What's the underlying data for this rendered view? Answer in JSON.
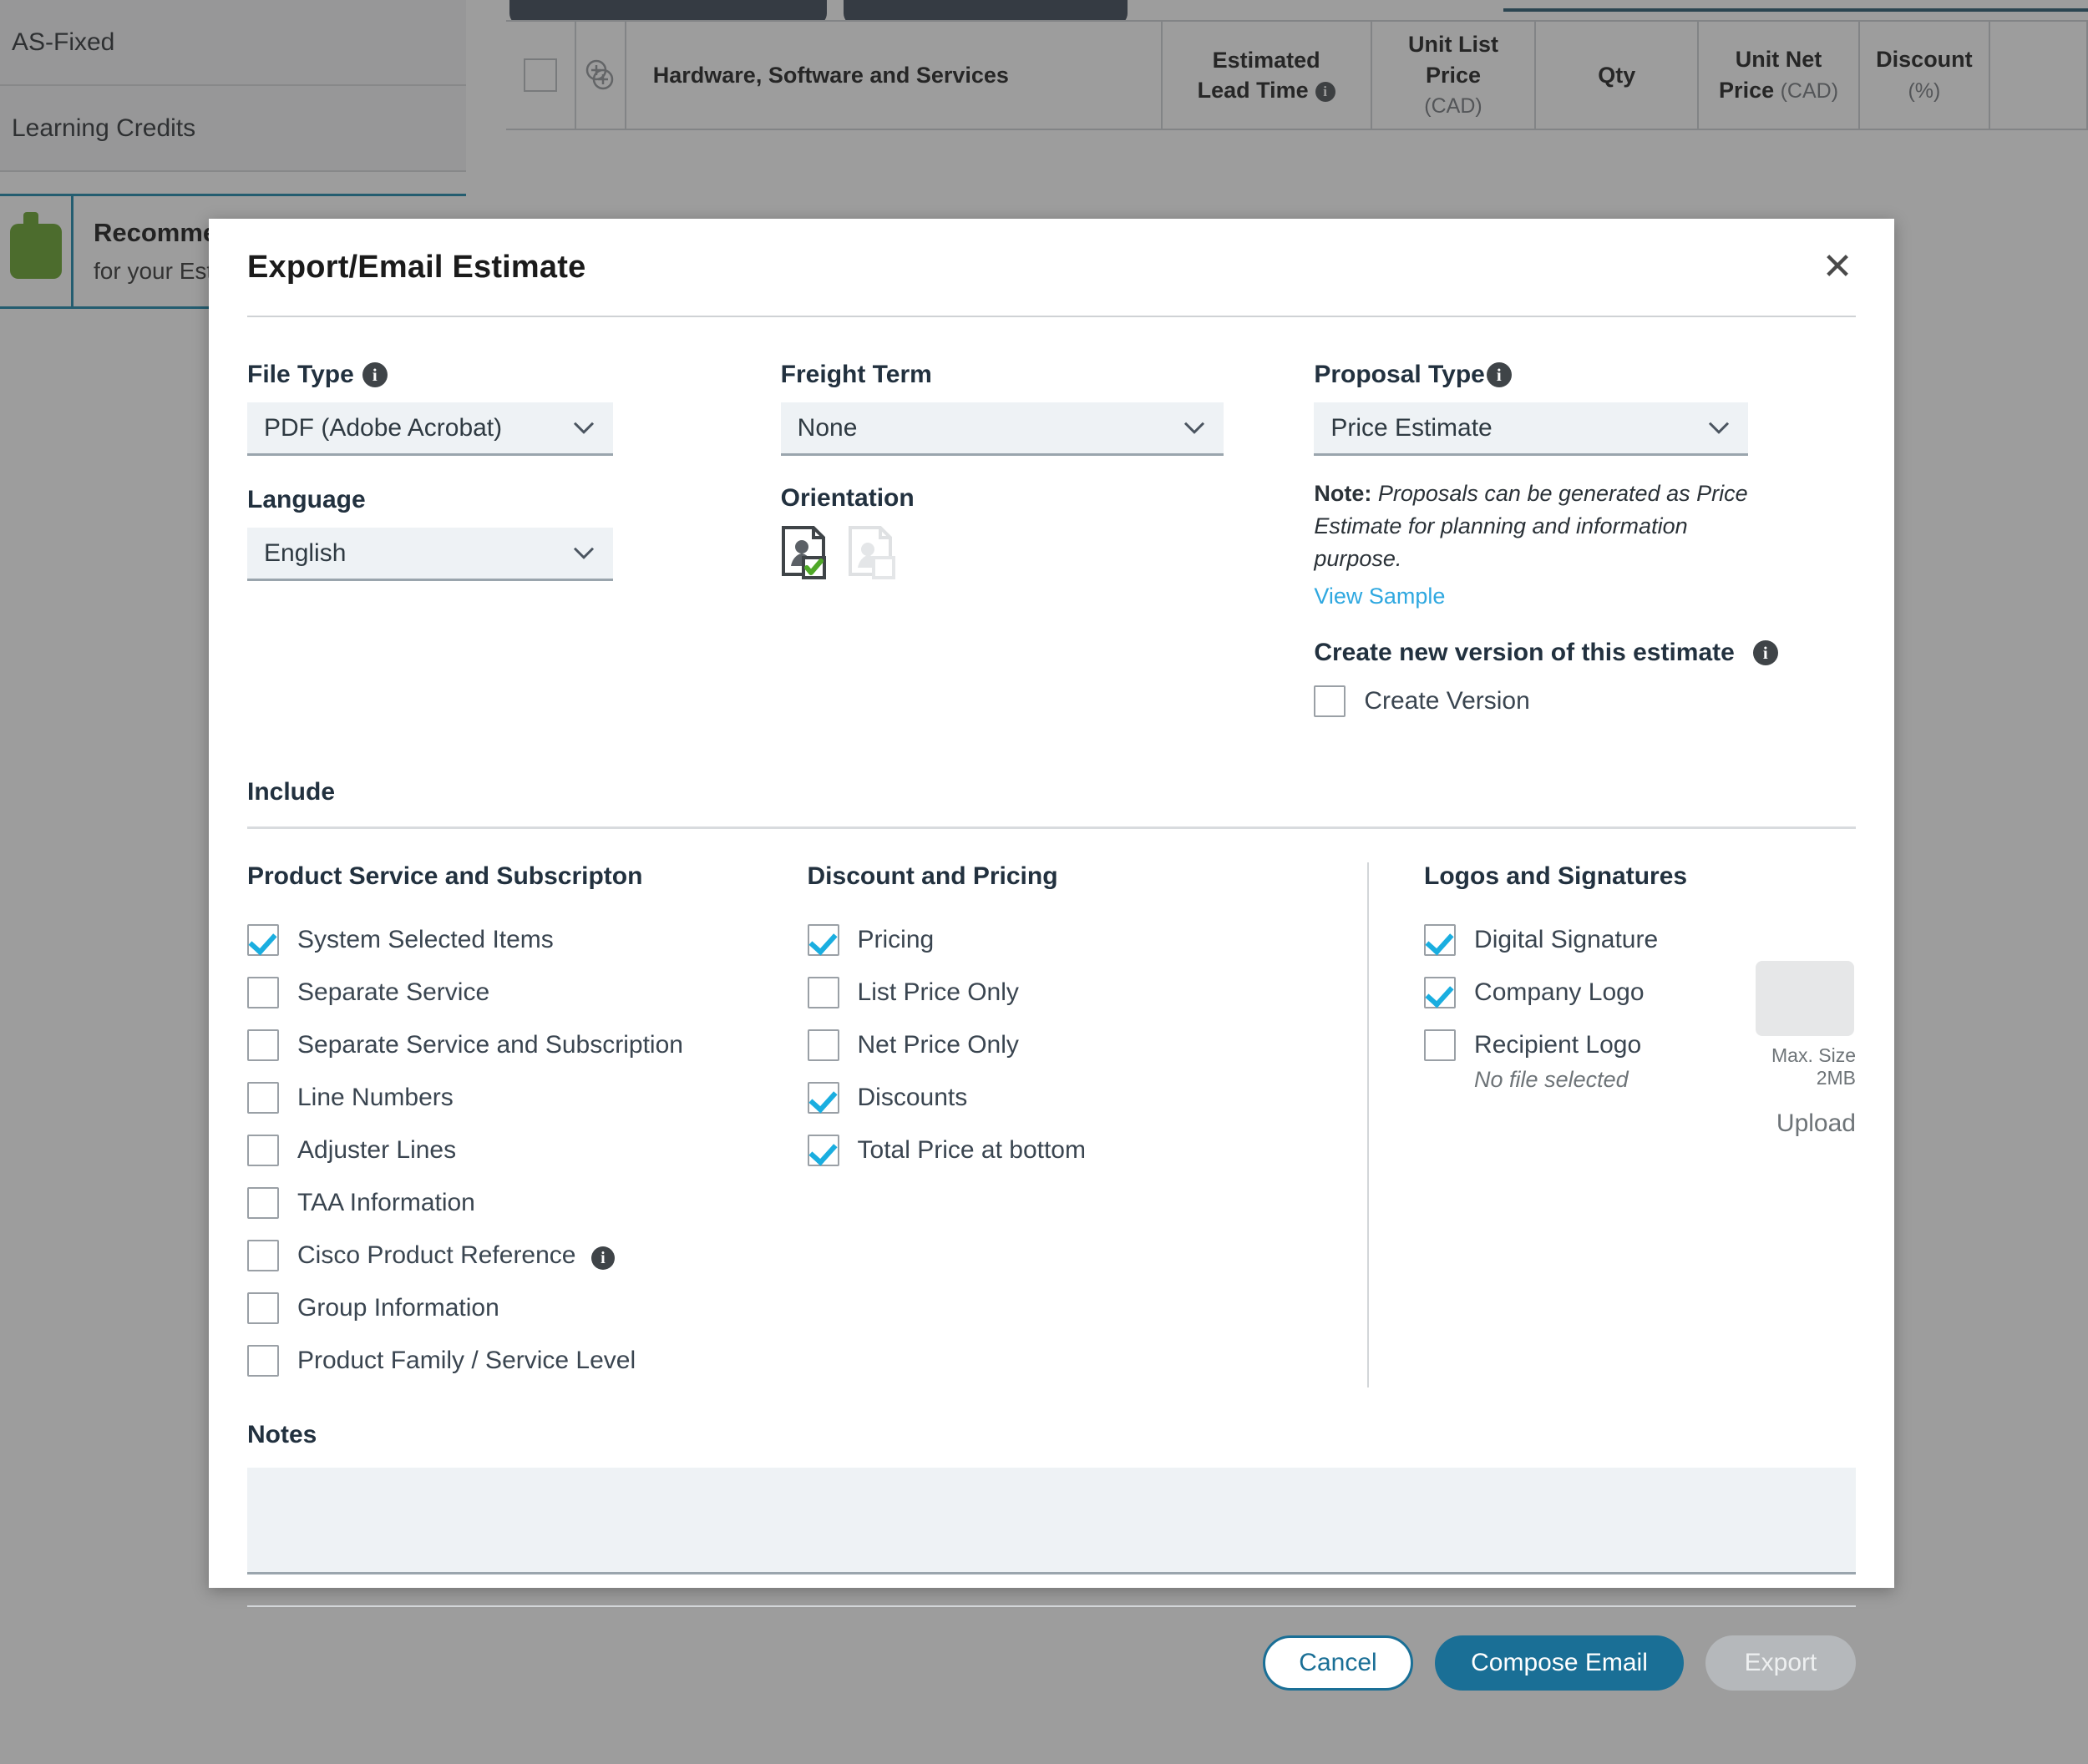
{
  "background": {
    "sidebar_items": [
      {
        "label": "AS-Fixed"
      },
      {
        "label": "Learning Credits"
      }
    ],
    "recommendation_card": {
      "title": "Recomme",
      "subtitle": "for your Esti"
    },
    "table_headers": [
      {
        "label": "Hardware, Software and Services",
        "sub": ""
      },
      {
        "label": "Estimated Lead Time",
        "sub": "",
        "info": true
      },
      {
        "label": "Unit List Price",
        "sub": "(CAD)"
      },
      {
        "label": "Qty",
        "sub": ""
      },
      {
        "label": "Unit Net Price",
        "sub": "(CAD)"
      },
      {
        "label": "Discount",
        "sub": "(%)"
      }
    ]
  },
  "dialog": {
    "title": "Export/Email Estimate",
    "close_icon": "✕",
    "file_type": {
      "label": "File Type",
      "value": "PDF (Adobe Acrobat)",
      "has_info": true
    },
    "language": {
      "label": "Language",
      "value": "English"
    },
    "freight_term": {
      "label": "Freight Term",
      "value": "None"
    },
    "orientation": {
      "label": "Orientation",
      "portrait_selected": true,
      "landscape_selected": false
    },
    "proposal_type": {
      "label": "Proposal Type",
      "value": "Price Estimate",
      "has_info": true,
      "note_prefix": "Note:",
      "note_text": " Proposals can be generated as Price Estimate for planning and information purpose.",
      "view_sample_link": "View Sample"
    },
    "create_version": {
      "heading": "Create new version of this estimate",
      "checkbox_label": "Create Version",
      "checked": false
    },
    "include": {
      "heading": "Include",
      "groups": [
        {
          "title": "Product Service and Subscripton",
          "items": [
            {
              "label": "System Selected Items",
              "checked": true
            },
            {
              "label": "Separate Service",
              "checked": false
            },
            {
              "label": "Separate Service and Subscription",
              "checked": false
            },
            {
              "label": "Line Numbers",
              "checked": false
            },
            {
              "label": "Adjuster Lines",
              "checked": false
            },
            {
              "label": "TAA Information",
              "checked": false
            },
            {
              "label": "Cisco Product Reference",
              "checked": false,
              "info": true
            },
            {
              "label": "Group Information",
              "checked": false
            },
            {
              "label": "Product Family / Service Level",
              "checked": false
            }
          ]
        },
        {
          "title": "Discount and Pricing",
          "items": [
            {
              "label": "Pricing",
              "checked": true
            },
            {
              "label": "List Price Only",
              "checked": false
            },
            {
              "label": "Net Price Only",
              "checked": false
            },
            {
              "label": "Discounts",
              "checked": true
            },
            {
              "label": "Total Price at bottom",
              "checked": true
            }
          ]
        },
        {
          "title": "Logos and Signatures",
          "items": [
            {
              "label": "Digital Signature",
              "checked": true
            },
            {
              "label": "Company Logo",
              "checked": true
            },
            {
              "label": "Recipient Logo",
              "checked": false
            }
          ],
          "no_file_text": "No file selected",
          "max_size_text": "Max. Size 2MB",
          "upload_label": "Upload"
        }
      ]
    },
    "notes": {
      "label": "Notes",
      "value": "",
      "placeholder": ""
    },
    "actions": {
      "cancel": "Cancel",
      "compose_email": "Compose Email",
      "export": "Export"
    },
    "colors": {
      "primary": "#1a6f96",
      "link": "#2fa8e0",
      "check": "#1aaee0",
      "disabled": "#b5b8bb"
    }
  }
}
